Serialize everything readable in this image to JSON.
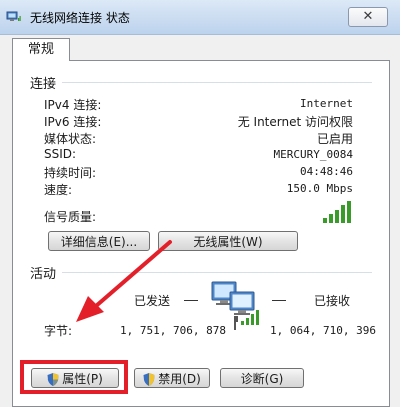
{
  "window": {
    "title": "无线网络连接 状态",
    "close_label": "✕"
  },
  "tabs": [
    {
      "label": "常规"
    }
  ],
  "connection": {
    "section_label": "连接",
    "rows": [
      {
        "label": "IPv4 连接:",
        "value": "Internet"
      },
      {
        "label": "IPv6 连接:",
        "value": "无 Internet 访问权限"
      },
      {
        "label": "媒体状态:",
        "value": "已启用"
      },
      {
        "label": "SSID:",
        "value": "MERCURY_0084"
      },
      {
        "label": "持续时间:",
        "value": "04:48:46"
      },
      {
        "label": "速度:",
        "value": "150.0 Mbps"
      }
    ],
    "signal_label": "信号质量:",
    "signal_bars": 5,
    "details_button": "详细信息(E)...",
    "wireless_props_button": "无线属性(W)"
  },
  "activity": {
    "section_label": "活动",
    "sent_label": "已发送",
    "received_label": "已接收",
    "bytes_label": "字节:",
    "bytes_sent": "1, 751, 706, 878",
    "bytes_received": "1, 064, 710, 396"
  },
  "buttons": {
    "properties": "属性(P)",
    "disable": "禁用(D)",
    "diagnose": "诊断(G)"
  },
  "colors": {
    "highlight": "#e3202a",
    "signal": "#3a9a2a"
  }
}
